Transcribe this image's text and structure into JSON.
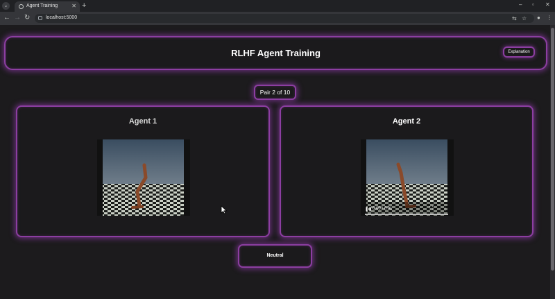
{
  "browser": {
    "tab_title": "Agent Training",
    "url": "localhost:5000",
    "icons": [
      "tab-search-icon",
      "favicon-icon",
      "close-icon",
      "new-tab-icon",
      "minimize-icon",
      "maximize-icon",
      "window-close-icon",
      "back-icon",
      "forward-icon",
      "reload-icon",
      "site-info-icon",
      "translate-icon",
      "star-icon",
      "profile-icon",
      "menu-icon"
    ]
  },
  "header": {
    "title": "RLHF Agent Training",
    "explanation_label": "Explanation"
  },
  "pair_counter": "Pair 2 of 10",
  "agents": [
    {
      "title": "Agent 1"
    },
    {
      "title": "Agent 2",
      "video_time": "0:00 / 0:01"
    }
  ],
  "neutral_label": "Neutral",
  "colors": {
    "accent_glow": "#8c3ea1",
    "page_background": "#1c1b1d",
    "card_background": "#1b1a1c",
    "text": "#ffffff"
  }
}
